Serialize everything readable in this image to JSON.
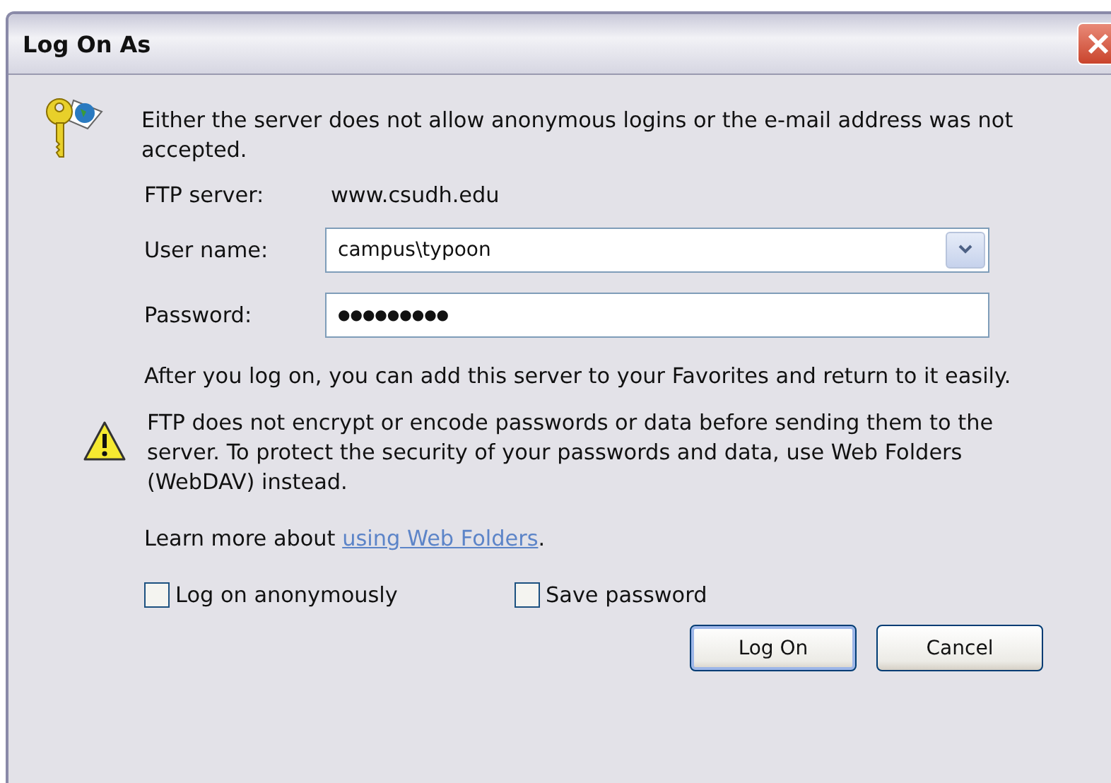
{
  "window": {
    "title": "Log On As"
  },
  "message": "Either the server does not allow anonymous logins or the e-mail address was not accepted.",
  "server": {
    "label": "FTP server:",
    "value": "www.csudh.edu"
  },
  "user_name": {
    "label": "User name:",
    "value": "campus\\typoon"
  },
  "password": {
    "label": "Password:",
    "value": "●●●●●●●●●"
  },
  "info": "After you log on, you can add this server to your Favorites and return to it easily.",
  "warning": "FTP does not encrypt or encode passwords or data before sending them to the server.  To protect the security of your passwords and data, use Web Folders (WebDAV) instead.",
  "learn_more": {
    "text": "Learn more about ",
    "link": "using Web Folders",
    "end": "."
  },
  "options": [
    {
      "label": "Log on anonymously",
      "checked": false
    },
    {
      "label": "Save password",
      "checked": false
    }
  ],
  "buttons": [
    {
      "label": "Log On",
      "default": true
    },
    {
      "label": "Cancel",
      "default": false
    }
  ]
}
